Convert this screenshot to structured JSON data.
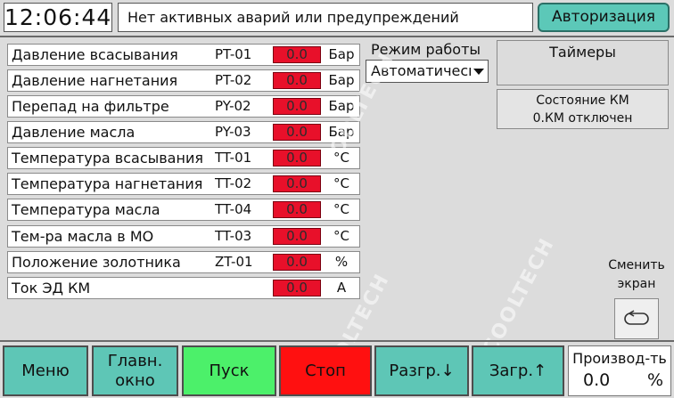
{
  "header": {
    "clock": "12:06:44",
    "alarm_text": "Нет активных аварий или предупреждений",
    "auth_label": "Авторизация"
  },
  "params": [
    {
      "name": "Давление всасывания",
      "tag": "PT-01",
      "value": "0.0",
      "unit": "Бар"
    },
    {
      "name": "Давление нагнетания",
      "tag": "PT-02",
      "value": "0.0",
      "unit": "Бар"
    },
    {
      "name": "Перепад на фильтре",
      "tag": "PY-02",
      "value": "0.0",
      "unit": "Бар"
    },
    {
      "name": "Давление масла",
      "tag": "PY-03",
      "value": "0.0",
      "unit": "Бар"
    },
    {
      "name": "Температура всасывания",
      "tag": "TT-01",
      "value": "0.0",
      "unit": "°C"
    },
    {
      "name": "Температура нагнетания",
      "tag": "TT-02",
      "value": "0.0",
      "unit": "°C"
    },
    {
      "name": "Температура масла",
      "tag": "TT-04",
      "value": "0.0",
      "unit": "°C"
    },
    {
      "name": "Тем-ра масла в МО",
      "tag": "TT-03",
      "value": "0.0",
      "unit": "°C"
    },
    {
      "name": "Положение золотника",
      "tag": "ZT-01",
      "value": "0.0",
      "unit": "%"
    },
    {
      "name": "Ток ЭД КМ",
      "tag": "",
      "value": "0.0",
      "unit": "A"
    }
  ],
  "mode": {
    "label": "Режим работы",
    "value": "Автоматический"
  },
  "timers_label": "Таймеры",
  "km_state": {
    "label": "Состояние КМ",
    "value": "0.КМ отключен"
  },
  "switch_screen": {
    "line1": "Сменить",
    "line2": "экран"
  },
  "watermark": "COOLTECH",
  "bottom": {
    "menu": "Меню",
    "main_line1": "Главн.",
    "main_line2": "окно",
    "start": "Пуск",
    "stop": "Стоп",
    "unload": "Разгр.↓",
    "load": "Загр.↑",
    "productivity_label": "Производ-ть",
    "productivity_value": "0.0",
    "productivity_unit": "%"
  },
  "colors": {
    "accent_teal": "#5ec6b6",
    "start_green": "#4cf06a",
    "stop_red": "#ff1010",
    "value_red": "#e8102a"
  }
}
